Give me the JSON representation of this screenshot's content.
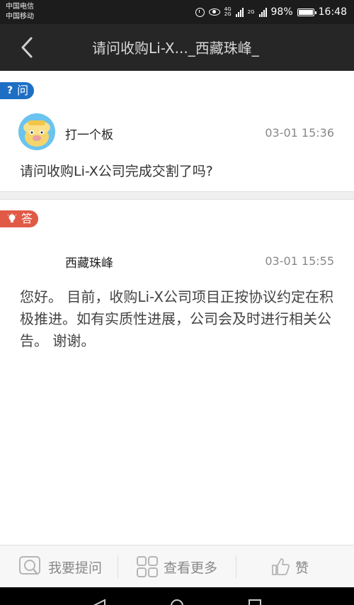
{
  "status_bar": {
    "carrier_1": "中国电信",
    "carrier_2": "中国移动",
    "net_1_top": "4G",
    "net_1_bottom": "2G",
    "net_2_top": "2G",
    "battery_text": "98%",
    "battery_level": 0.98,
    "time": "16:48"
  },
  "header": {
    "title": "请问收购Li-X..._西藏珠峰_"
  },
  "question": {
    "badge_label": "问",
    "badge_icon": "?",
    "user": "打一个板",
    "time": "03-01 15:36",
    "text": "请问收购Li-X公司完成交割了吗?"
  },
  "answer": {
    "badge_label": "答",
    "user": "西藏珠峰",
    "time": "03-01 15:55",
    "text": "您好。 目前，收购Li-X公司项目正按协议约定在积极推进。如有实质性进展，公司会及时进行相关公告。 谢谢。"
  },
  "toolbar": {
    "ask_label": "我要提问",
    "more_label": "查看更多",
    "like_label": "赞"
  },
  "colors": {
    "ask_badge": "#1e6fc4",
    "answer_badge": "#e15a46",
    "header_bg": "#262626"
  }
}
